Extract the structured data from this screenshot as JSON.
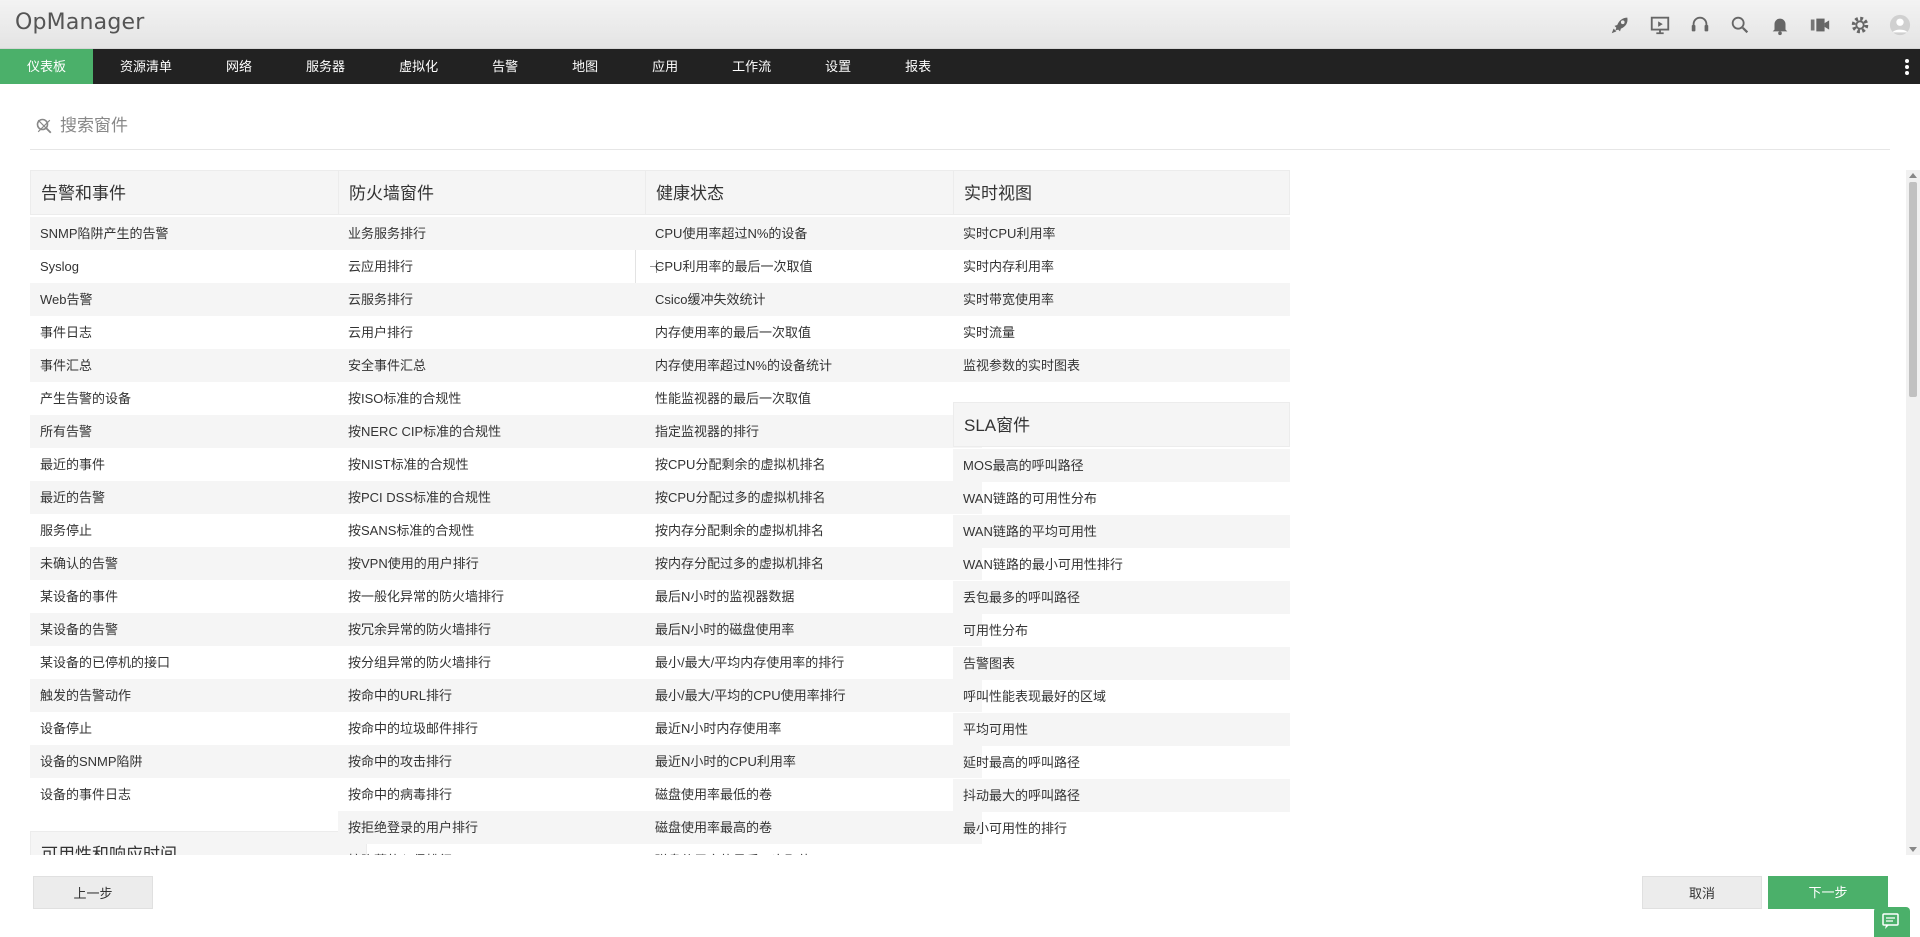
{
  "app": {
    "title": "OpManager"
  },
  "header_icons": [
    "rocket-icon",
    "presentation-icon",
    "headset-icon",
    "search-icon",
    "bell-icon",
    "video-icon",
    "gear-icon",
    "user-avatar-icon"
  ],
  "nav": {
    "items": [
      "仪表板",
      "资源清单",
      "网络",
      "服务器",
      "虚拟化",
      "告警",
      "地图",
      "应用",
      "工作流",
      "设置",
      "报表"
    ],
    "active_index": 0
  },
  "search": {
    "placeholder": "搜索窗件"
  },
  "columns": [
    {
      "sections": [
        {
          "title": "告警和事件",
          "items": [
            "SNMP陷阱产生的告警",
            "Syslog",
            "Web告警",
            "事件日志",
            "事件汇总",
            "产生告警的设备",
            "所有告警",
            "最近的事件",
            "最近的告警",
            "服务停止",
            "未确认的告警",
            "某设备的事件",
            "某设备的告警",
            "某设备的已停机的接口",
            "触发的告警动作",
            "设备停止",
            "设备的SNMP陷阱",
            "设备的事件日志"
          ]
        },
        {
          "title": "可用性和响应时间",
          "items": []
        }
      ]
    },
    {
      "sections": [
        {
          "title": "防火墙窗件",
          "items": [
            "业务服务排行",
            "云应用排行",
            "云服务排行",
            "云用户排行",
            "安全事件汇总",
            "按ISO标准的合规性",
            "按NERC CIP标准的合规性",
            "按NIST标准的合规性",
            "按PCI DSS标准的合规性",
            "按SANS标准的合规性",
            "按VPN使用的用户排行",
            "按一般化异常的防火墙排行",
            "按冗余异常的防火墙排行",
            "按分组异常的防火墙排行",
            "按命中的URL排行",
            "按命中的垃圾邮件排行",
            "按命中的攻击排行",
            "按命中的病毒排行",
            "按拒绝登录的用户排行",
            "按隐藏的入侵排行"
          ],
          "checked_index": 0,
          "hover_index": 1
        }
      ]
    },
    {
      "sections": [
        {
          "title": "健康状态",
          "items": [
            "CPU使用率超过N%的设备",
            "CPU利用率的最后一次取值",
            "Csico缓冲失效统计",
            "内存使用率的最后一次取值",
            "内存使用率超过N%的设备统计",
            "性能监视器的最后一次取值",
            "指定监视器的排行",
            "按CPU分配剩余的虚拟机排名",
            "按CPU分配过多的虚拟机排名",
            "按内存分配剩余的虚拟机排名",
            "按内存分配过多的虚拟机排名",
            "最后N小时的监视器数据",
            "最后N小时的磁盘使用率",
            "最小/最大/平均内存使用率的排行",
            "最小/最大/平均的CPU使用率排行",
            "最近N小时内存使用率",
            "最近N小时的CPU利用率",
            "磁盘使用率最低的卷",
            "磁盘使用率最高的卷",
            "磁盘使用率的最后一次取值"
          ]
        }
      ]
    },
    {
      "sections": [
        {
          "title": "实时视图",
          "items": [
            "实时CPU利用率",
            "实时内存利用率",
            "实时带宽使用率",
            "实时流量",
            "监视参数的实时图表"
          ]
        },
        {
          "title": "SLA窗件",
          "items": [
            "MOS最高的呼叫路径",
            "WAN链路的可用性分布",
            "WAN链路的平均可用性",
            "WAN链路的最小可用性排行",
            "丢包最多的呼叫路径",
            "可用性分布",
            "告警图表",
            "呼叫性能表现最好的区域",
            "平均可用性",
            "延时最高的呼叫路径",
            "抖动最大的呼叫路径",
            "最小可用性的排行"
          ]
        }
      ]
    }
  ],
  "footer": {
    "prev_label": "上一步",
    "cancel_label": "取消",
    "next_label": "下一步"
  },
  "colors": {
    "accent": "#4bb06a",
    "nav_bg": "#222222"
  }
}
